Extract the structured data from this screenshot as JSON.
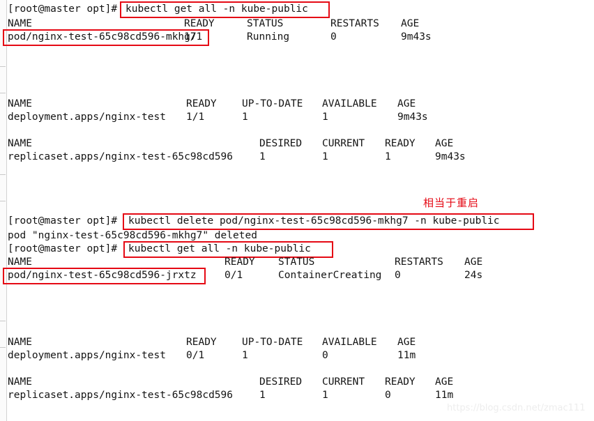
{
  "terminal": {
    "prompt": "[root@master opt]#",
    "background_color": "#ffffff",
    "text_color": "#141414",
    "annotation_color": "#e50914"
  },
  "commands": {
    "get_all_1": "kubectl get all -n kube-public",
    "delete_pod": "kubectl delete pod/nginx-test-65c98cd596-mkhg7 -n kube-public",
    "get_all_2": "kubectl get all -n kube-public"
  },
  "output": {
    "deleted_message": "pod \"nginx-test-65c98cd596-mkhg7\" deleted"
  },
  "annotations": {
    "restart_note": "相当于重启"
  },
  "watermark": {
    "text": "https://blog.csdn.net/zmac111"
  },
  "section1": {
    "pod_table": {
      "headers": {
        "name": "NAME",
        "ready": "READY",
        "status": "STATUS",
        "restarts": "RESTARTS",
        "age": "AGE"
      },
      "row": {
        "name": "pod/nginx-test-65c98cd596-mkhg7",
        "ready": "1/1",
        "status": "Running",
        "restarts": "0",
        "age": "9m43s"
      }
    },
    "deployment_table": {
      "headers": {
        "name": "NAME",
        "ready": "READY",
        "uptodate": "UP-TO-DATE",
        "available": "AVAILABLE",
        "age": "AGE"
      },
      "row": {
        "name": "deployment.apps/nginx-test",
        "ready": "1/1",
        "uptodate": "1",
        "available": "1",
        "age": "9m43s"
      }
    },
    "replicaset_table": {
      "headers": {
        "name": "NAME",
        "desired": "DESIRED",
        "current": "CURRENT",
        "ready": "READY",
        "age": "AGE"
      },
      "row": {
        "name": "replicaset.apps/nginx-test-65c98cd596",
        "desired": "1",
        "current": "1",
        "ready": "1",
        "age": "9m43s"
      }
    }
  },
  "section2": {
    "pod_table": {
      "headers": {
        "name": "NAME",
        "ready": "READY",
        "status": "STATUS",
        "restarts": "RESTARTS",
        "age": "AGE"
      },
      "row": {
        "name": "pod/nginx-test-65c98cd596-jrxtz",
        "ready": "0/1",
        "status": "ContainerCreating",
        "restarts": "0",
        "age": "24s"
      }
    },
    "deployment_table": {
      "headers": {
        "name": "NAME",
        "ready": "READY",
        "uptodate": "UP-TO-DATE",
        "available": "AVAILABLE",
        "age": "AGE"
      },
      "row": {
        "name": "deployment.apps/nginx-test",
        "ready": "0/1",
        "uptodate": "1",
        "available": "0",
        "age": "11m"
      }
    },
    "replicaset_table": {
      "headers": {
        "name": "NAME",
        "desired": "DESIRED",
        "current": "CURRENT",
        "ready": "READY",
        "age": "AGE"
      },
      "row": {
        "name": "replicaset.apps/nginx-test-65c98cd596",
        "desired": "1",
        "current": "1",
        "ready": "0",
        "age": "11m"
      }
    }
  }
}
